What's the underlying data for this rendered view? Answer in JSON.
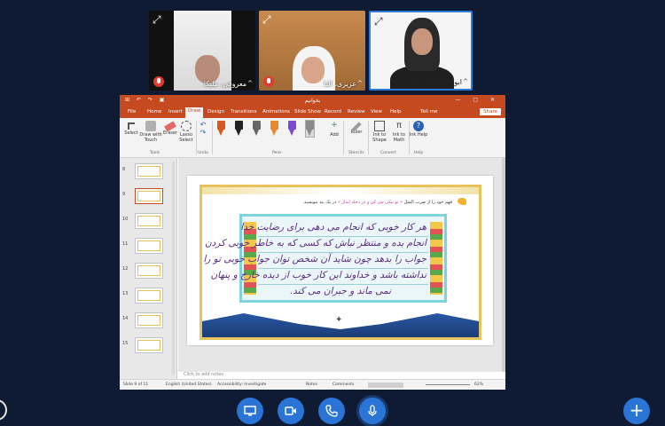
{
  "participants": [
    {
      "name": "معروفی، ملیکا"
    },
    {
      "name": "عزیزی، النا"
    },
    {
      "name": "ابوالمعصومی، م..."
    }
  ],
  "ppt": {
    "doc_title": "بخوانیم",
    "quick_access": "⊞ ↶ ↷ ▣",
    "tabs": [
      "File",
      "Home",
      "Insert",
      "Draw",
      "Design",
      "Transitions",
      "Animations",
      "Slide Show",
      "Record",
      "Review",
      "View",
      "Help",
      "Tell me"
    ],
    "active_tab": "Draw",
    "share_label": "Share",
    "ribbon": {
      "select": "Select",
      "draw_touch": "Draw with Touch",
      "eraser": "Eraser",
      "lasso": "Lasso Select",
      "group_tools": "Tools",
      "group_undo": "Undo",
      "group_pens": "Pens",
      "add": "Add",
      "ruler": "Ruler",
      "ink_shape": "Ink to Shape",
      "ink_math": "Ink to Math",
      "ink_help": "Ink Help",
      "group_stencils": "Stencils",
      "group_convert": "Convert",
      "group_help": "Help"
    },
    "pen_colors": [
      "#d8581f",
      "#222222",
      "#666666",
      "#e8892a",
      "#7a4bd0",
      "#8a8a8a"
    ],
    "thumb_numbers": [
      "8",
      "9",
      "10",
      "11",
      "12",
      "13",
      "14",
      "15"
    ],
    "slide": {
      "instruction_pre": "فهم خود را از ضرب المثل",
      "instruction_hl": "« تو نیکی می کن و در دجله انداز »",
      "instruction_post": "در یک بند بنویسید.",
      "handwriting": [
        "هر کار خوبی که انجام می دهی برای رضایت خدا",
        "انجام بده و منتظر نباش که کسی که به خاطر خوبی کردن",
        "جواب را بدهد چون شاید آن شخص توان جواب خوبی تو را",
        "نداشته باشد و خداوند این کار خوب از دیده خارج و پنهان",
        "نمی ماند و جبران می کند."
      ]
    },
    "notes_placeholder": "Click to add notes",
    "status": {
      "slide": "Slide 9 of 11",
      "lang": "English (United States)",
      "accessibility": "Accessibility: Investigate",
      "notes": "Notes",
      "comments": "Comments",
      "zoom": "62%"
    }
  },
  "controls": {
    "plus": "+"
  }
}
